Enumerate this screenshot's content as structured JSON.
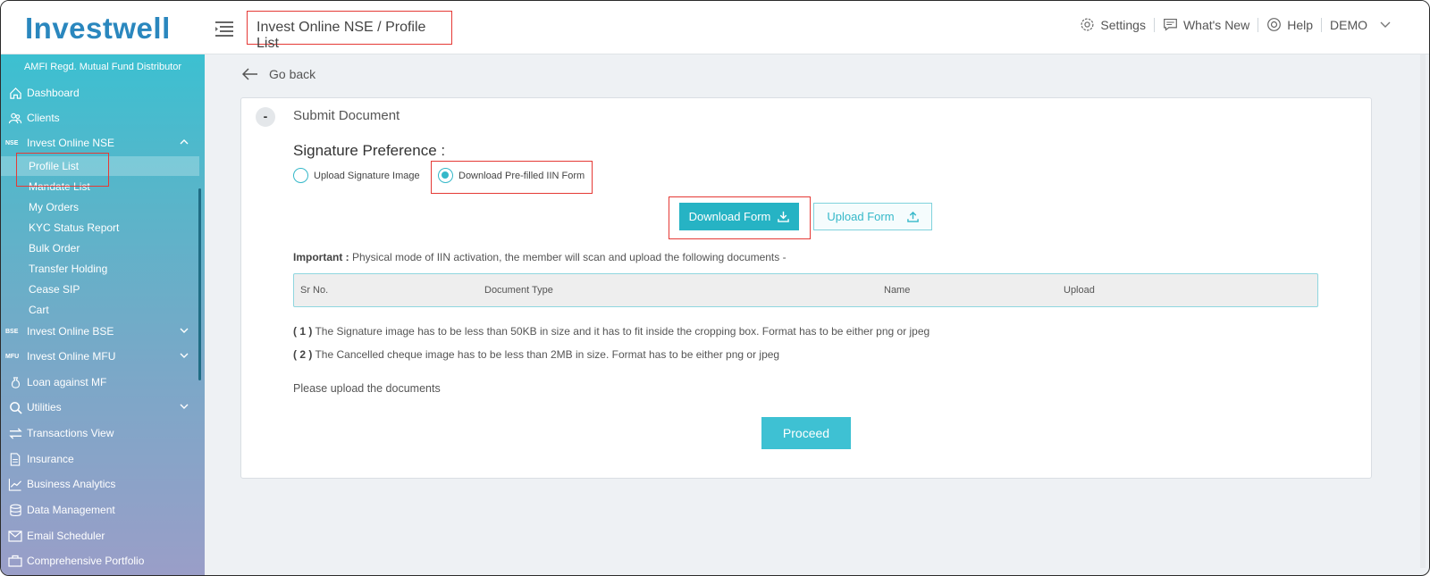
{
  "header": {
    "logo": "Investwell",
    "breadcrumb": "Invest Online NSE / Profile List",
    "settings": "Settings",
    "whats_new": "What's New",
    "help": "Help",
    "user": "DEMO"
  },
  "sidebar": {
    "subtitle": "AMFI Regd. Mutual Fund Distributor",
    "dashboard": "Dashboard",
    "clients": "Clients",
    "nse_tag": "NSE",
    "invest_nse": "Invest Online NSE",
    "nse_children": [
      "Profile List",
      "Mandate List",
      "My Orders",
      "KYC Status Report",
      "Bulk Order",
      "Transfer Holding",
      "Cease SIP",
      "Cart"
    ],
    "bse_tag": "BSE",
    "invest_bse": "Invest Online BSE",
    "mfu_tag": "MFU",
    "invest_mfu": "Invest Online MFU",
    "loan": "Loan against MF",
    "utilities": "Utilities",
    "transactions": "Transactions View",
    "insurance": "Insurance",
    "analytics": "Business Analytics",
    "data_mgmt": "Data Management",
    "email": "Email Scheduler",
    "portfolio": "Comprehensive Portfolio"
  },
  "main": {
    "go_back": "Go back",
    "collapse": "-",
    "card_title": "Submit Document",
    "sig_pref": "Signature Preference :",
    "radio_upload": "Upload Signature Image",
    "radio_download": "Download Pre-filled IIN Form",
    "btn_download": "Download Form",
    "btn_upload": "Upload Form",
    "important_label": "Important :",
    "important_text": " Physical mode of IIN activation, the member will scan and upload the following documents -",
    "table_headers": [
      "Sr No.",
      "Document Type",
      "Name",
      "Upload"
    ],
    "note1_num": "( 1 )",
    "note1": " The Signature image has to be less than 50KB in size and it has to fit inside the cropping box. Format has to be either png or jpeg",
    "note2_num": "( 2 )",
    "note2": " The Cancelled cheque image has to be less than 2MB in size. Format has to be either png or jpeg",
    "please_upload": "Please upload the documents",
    "proceed": "Proceed"
  },
  "colors": {
    "accent": "#26b3c4",
    "highlight": "#e53935",
    "logo": "#2a87be"
  }
}
